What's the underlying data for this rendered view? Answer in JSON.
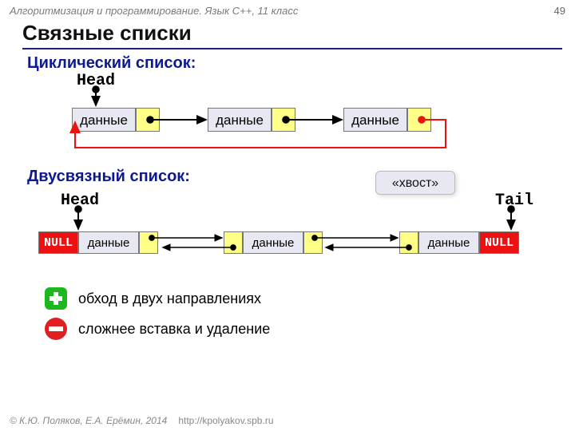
{
  "meta": {
    "course": "Алгоритмизация и программирование. Язык C++, 11 класс",
    "page": "49",
    "copyright": "© К.Ю. Поляков, Е.А. Ерёмин, 2014",
    "url": "http://kpolyakov.spb.ru"
  },
  "title": "Связные списки",
  "sections": {
    "circular": {
      "heading": "Циклический список:",
      "head_label": "Head",
      "nodes": [
        {
          "data": "данные"
        },
        {
          "data": "данные"
        },
        {
          "data": "данные"
        }
      ]
    },
    "doubly": {
      "heading": "Двусвязный список:",
      "head_label": "Head",
      "tail_label": "Tail",
      "tail_badge": "«хвост»",
      "null_text": "NULL",
      "nodes": [
        {
          "data": "данные"
        },
        {
          "data": "данные"
        },
        {
          "data": "данные"
        }
      ]
    }
  },
  "bullets": {
    "pro": "обход в двух направлениях",
    "con": "сложнее вставка и удаление"
  }
}
